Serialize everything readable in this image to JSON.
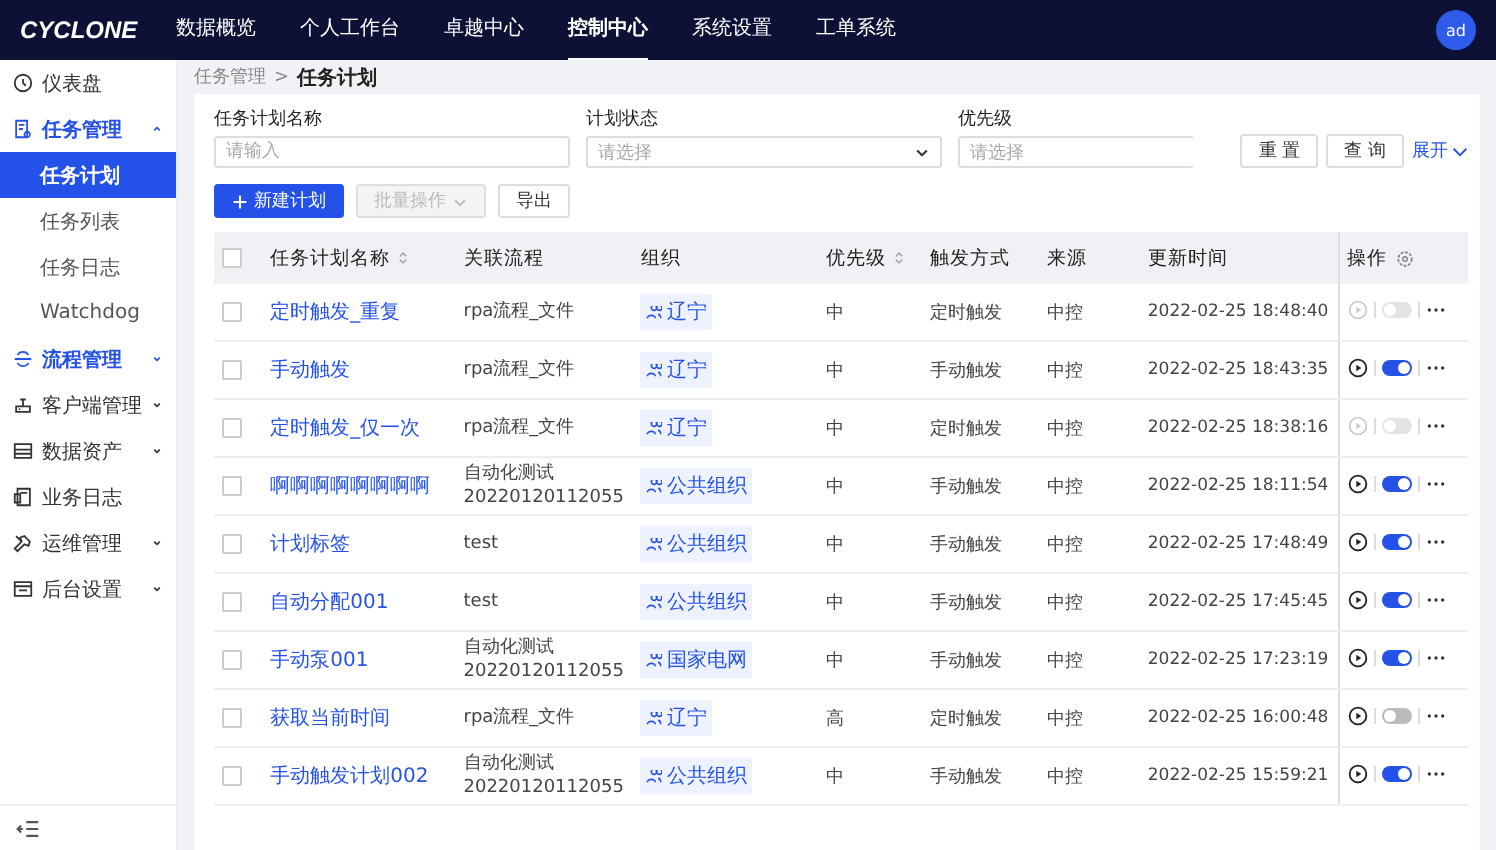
{
  "header": {
    "logo": "CYCLONE",
    "nav": [
      {
        "label": "数据概览",
        "selected": false
      },
      {
        "label": "个人工作台",
        "selected": false
      },
      {
        "label": "卓越中心",
        "selected": false
      },
      {
        "label": "控制中心",
        "selected": true
      },
      {
        "label": "系统设置",
        "selected": false
      },
      {
        "label": "工单系统",
        "selected": false
      }
    ],
    "avatar": "ad"
  },
  "sidebar": {
    "items": [
      {
        "label": "仪表盘",
        "highlighted": false
      },
      {
        "label": "任务管理",
        "highlighted": true,
        "expanded": true,
        "children": [
          {
            "label": "任务计划",
            "selected": true
          },
          {
            "label": "任务列表",
            "selected": false
          },
          {
            "label": "任务日志",
            "selected": false
          },
          {
            "label": "Watchdog",
            "selected": false
          }
        ]
      },
      {
        "label": "流程管理",
        "highlighted": true,
        "expanded": false
      },
      {
        "label": "客户端管理",
        "highlighted": false,
        "expanded": false
      },
      {
        "label": "数据资产",
        "highlighted": false,
        "expanded": false
      },
      {
        "label": "业务日志",
        "highlighted": false
      },
      {
        "label": "运维管理",
        "highlighted": false,
        "expanded": false
      },
      {
        "label": "后台设置",
        "highlighted": false,
        "expanded": false
      }
    ]
  },
  "breadcrumb": {
    "items": [
      "任务管理",
      "任务计划"
    ],
    "separator": ">"
  },
  "filters": [
    {
      "label": "任务计划名称",
      "kind": "input",
      "placeholder": "请输入"
    },
    {
      "label": "计划状态",
      "kind": "select",
      "placeholder": "请选择"
    },
    {
      "label": "优先级",
      "kind": "select-cut",
      "placeholder": "请选择"
    }
  ],
  "filter_buttons": {
    "reset": "重 置",
    "query": "查 询",
    "expand": "展开"
  },
  "toolbar": {
    "create": "新建计划",
    "batch": "批量操作",
    "export": "导出"
  },
  "table": {
    "select_all_checked": false,
    "columns": [
      {
        "label": "任务计划名称",
        "sortable": true
      },
      {
        "label": "关联流程",
        "sortable": false
      },
      {
        "label": "组织",
        "sortable": false
      },
      {
        "label": "优先级",
        "sortable": true
      },
      {
        "label": "触发方式",
        "sortable": false
      },
      {
        "label": "来源",
        "sortable": false
      },
      {
        "label": "更新时间",
        "sortable": false
      },
      {
        "label": "操作",
        "sortable": false
      }
    ],
    "rows": [
      {
        "checked": false,
        "name": "定时触发_重复",
        "flow": [
          "rpa流程_文件"
        ],
        "org": "辽宁",
        "priority": "中",
        "trigger": "定时触发",
        "source": "中控",
        "updated": "2022-02-25 18:48:40",
        "enabled": false,
        "disabled": true
      },
      {
        "checked": false,
        "name": "手动触发",
        "flow": [
          "rpa流程_文件"
        ],
        "org": "辽宁",
        "priority": "中",
        "trigger": "手动触发",
        "source": "中控",
        "updated": "2022-02-25 18:43:35",
        "enabled": true,
        "disabled": false
      },
      {
        "checked": false,
        "name": "定时触发_仅一次",
        "flow": [
          "rpa流程_文件"
        ],
        "org": "辽宁",
        "priority": "中",
        "trigger": "定时触发",
        "source": "中控",
        "updated": "2022-02-25 18:38:16",
        "enabled": false,
        "disabled": true
      },
      {
        "checked": false,
        "name": "啊啊啊啊啊啊啊啊",
        "flow": [
          "自动化测试",
          "20220120112055"
        ],
        "org": "公共组织",
        "priority": "中",
        "trigger": "手动触发",
        "source": "中控",
        "updated": "2022-02-25 18:11:54",
        "enabled": true,
        "disabled": false
      },
      {
        "checked": false,
        "name": "计划标签",
        "flow": [
          "test"
        ],
        "org": "公共组织",
        "priority": "中",
        "trigger": "手动触发",
        "source": "中控",
        "updated": "2022-02-25 17:48:49",
        "enabled": true,
        "disabled": false
      },
      {
        "checked": false,
        "name": "自动分配001",
        "flow": [
          "test"
        ],
        "org": "公共组织",
        "priority": "中",
        "trigger": "手动触发",
        "source": "中控",
        "updated": "2022-02-25 17:45:45",
        "enabled": true,
        "disabled": false
      },
      {
        "checked": false,
        "name": "手动泵001",
        "flow": [
          "自动化测试",
          "20220120112055"
        ],
        "org": "国家电网",
        "priority": "中",
        "trigger": "手动触发",
        "source": "中控",
        "updated": "2022-02-25 17:23:19",
        "enabled": true,
        "disabled": false
      },
      {
        "checked": false,
        "name": "获取当前时间",
        "flow": [
          "rpa流程_文件"
        ],
        "org": "辽宁",
        "priority": "高",
        "trigger": "定时触发",
        "source": "中控",
        "updated": "2022-02-25 16:00:48",
        "enabled": false,
        "disabled": false
      },
      {
        "checked": false,
        "name": "手动触发计划002",
        "flow": [
          "自动化测试",
          "20220120112055"
        ],
        "org": "公共组织",
        "priority": "中",
        "trigger": "手动触发",
        "source": "中控",
        "updated": "2022-02-25 15:59:21",
        "enabled": true,
        "disabled": false
      }
    ]
  }
}
